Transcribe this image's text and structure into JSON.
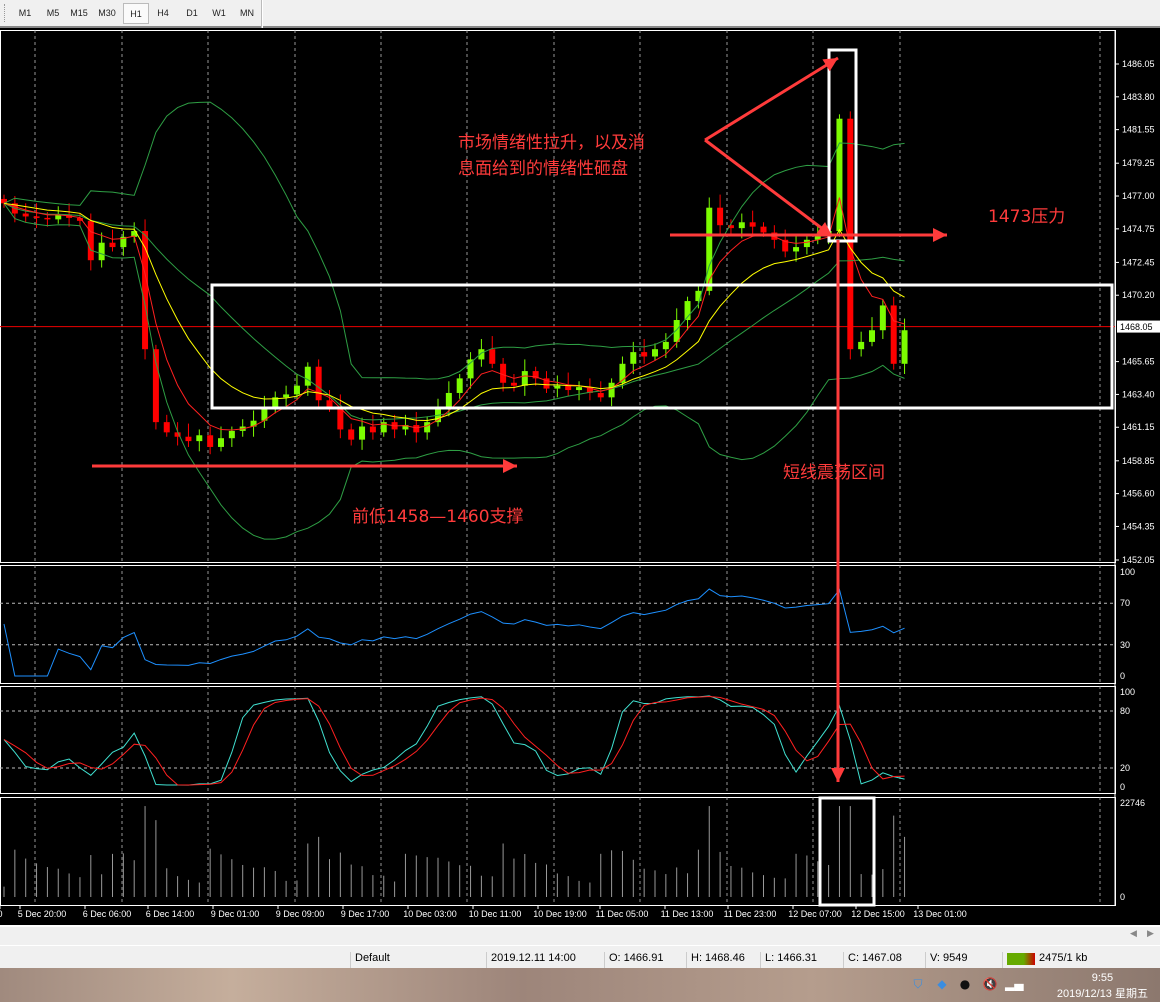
{
  "timeframes": [
    "M1",
    "M5",
    "M15",
    "M30",
    "H1",
    "H4",
    "D1",
    "W1",
    "MN"
  ],
  "active_timeframe": "H1",
  "price_axis": [
    "1486.05",
    "1483.80",
    "1481.55",
    "1479.25",
    "1477.00",
    "1474.75",
    "1472.45",
    "1470.20",
    "1465.65",
    "1463.40",
    "1461.15",
    "1458.85",
    "1456.60",
    "1454.35",
    "1452.05"
  ],
  "current_price": "1468.05",
  "rsi_levels": [
    "100",
    "70",
    "30",
    "0"
  ],
  "stoch_levels": [
    "100",
    "80",
    "20",
    "0"
  ],
  "volume_levels": [
    "22746",
    "0"
  ],
  "time_axis": [
    "0",
    "5 Dec 20:00",
    "6 Dec 06:00",
    "6 Dec 14:00",
    "9 Dec 01:00",
    "9 Dec 09:00",
    "9 Dec 17:00",
    "10 Dec 03:00",
    "10 Dec 11:00",
    "10 Dec 19:00",
    "11 Dec 05:00",
    "11 Dec 13:00",
    "11 Dec 23:00",
    "12 Dec 07:00",
    "12 Dec 15:00",
    "13 Dec 01:00"
  ],
  "annotations": {
    "sentiment_line1": "市场情绪性拉升，以及消",
    "sentiment_line2": "息面给到的情绪性砸盘",
    "resistance": "1473压力",
    "range": "短线震荡区间",
    "support": "前低1458—1460支撑"
  },
  "status": {
    "profile": "Default",
    "time": "2019.12.11 14:00",
    "open": "O: 1466.91",
    "high": "H: 1468.46",
    "low": "L: 1466.31",
    "close": "C: 1467.08",
    "volume": "V: 9549",
    "traffic": "2475/1 kb"
  },
  "taskbar": {
    "time": "9:55",
    "date": "2019/12/13 星期五"
  },
  "colors": {
    "bull": "#7cfc00",
    "bear": "#ff0000",
    "bands": "#2e9e44",
    "ma_fast": "#ff2020",
    "ma_slow": "#ffff00",
    "rsi": "#1e90ff",
    "stoch_main": "#40e0d0",
    "stoch_signal": "#ff2020",
    "annotation": "#ff3b3b"
  },
  "chart_data": {
    "type": "candlestick",
    "symbol_timeframe": "H1",
    "ylim": [
      1452.05,
      1486.05
    ],
    "closes": [
      1476.5,
      1475.8,
      1475.6,
      1475.5,
      1475.4,
      1475.7,
      1475.5,
      1475.3,
      1472.6,
      1473.8,
      1473.5,
      1474.2,
      1474.6,
      1466.5,
      1461.5,
      1460.8,
      1460.5,
      1460.2,
      1460.6,
      1459.8,
      1460.4,
      1460.9,
      1461.2,
      1461.6,
      1462.4,
      1463.2,
      1463.4,
      1464.0,
      1465.3,
      1463.0,
      1462.5,
      1461.0,
      1460.3,
      1461.2,
      1460.8,
      1461.5,
      1461.0,
      1461.3,
      1460.8,
      1461.5,
      1462.5,
      1463.5,
      1464.5,
      1465.8,
      1466.5,
      1465.5,
      1464.2,
      1464.0,
      1465.0,
      1464.5,
      1463.8,
      1464.0,
      1463.7,
      1463.9,
      1463.5,
      1463.2,
      1464.2,
      1465.5,
      1466.3,
      1466.0,
      1466.5,
      1467.0,
      1468.5,
      1469.8,
      1470.5,
      1476.2,
      1475.0,
      1474.8,
      1475.2,
      1474.9,
      1474.5,
      1474.0,
      1473.2,
      1473.5,
      1474.0,
      1474.3,
      1474.6,
      1482.3,
      1466.5,
      1467.0,
      1467.8,
      1469.5,
      1465.5,
      1467.8
    ]
  }
}
